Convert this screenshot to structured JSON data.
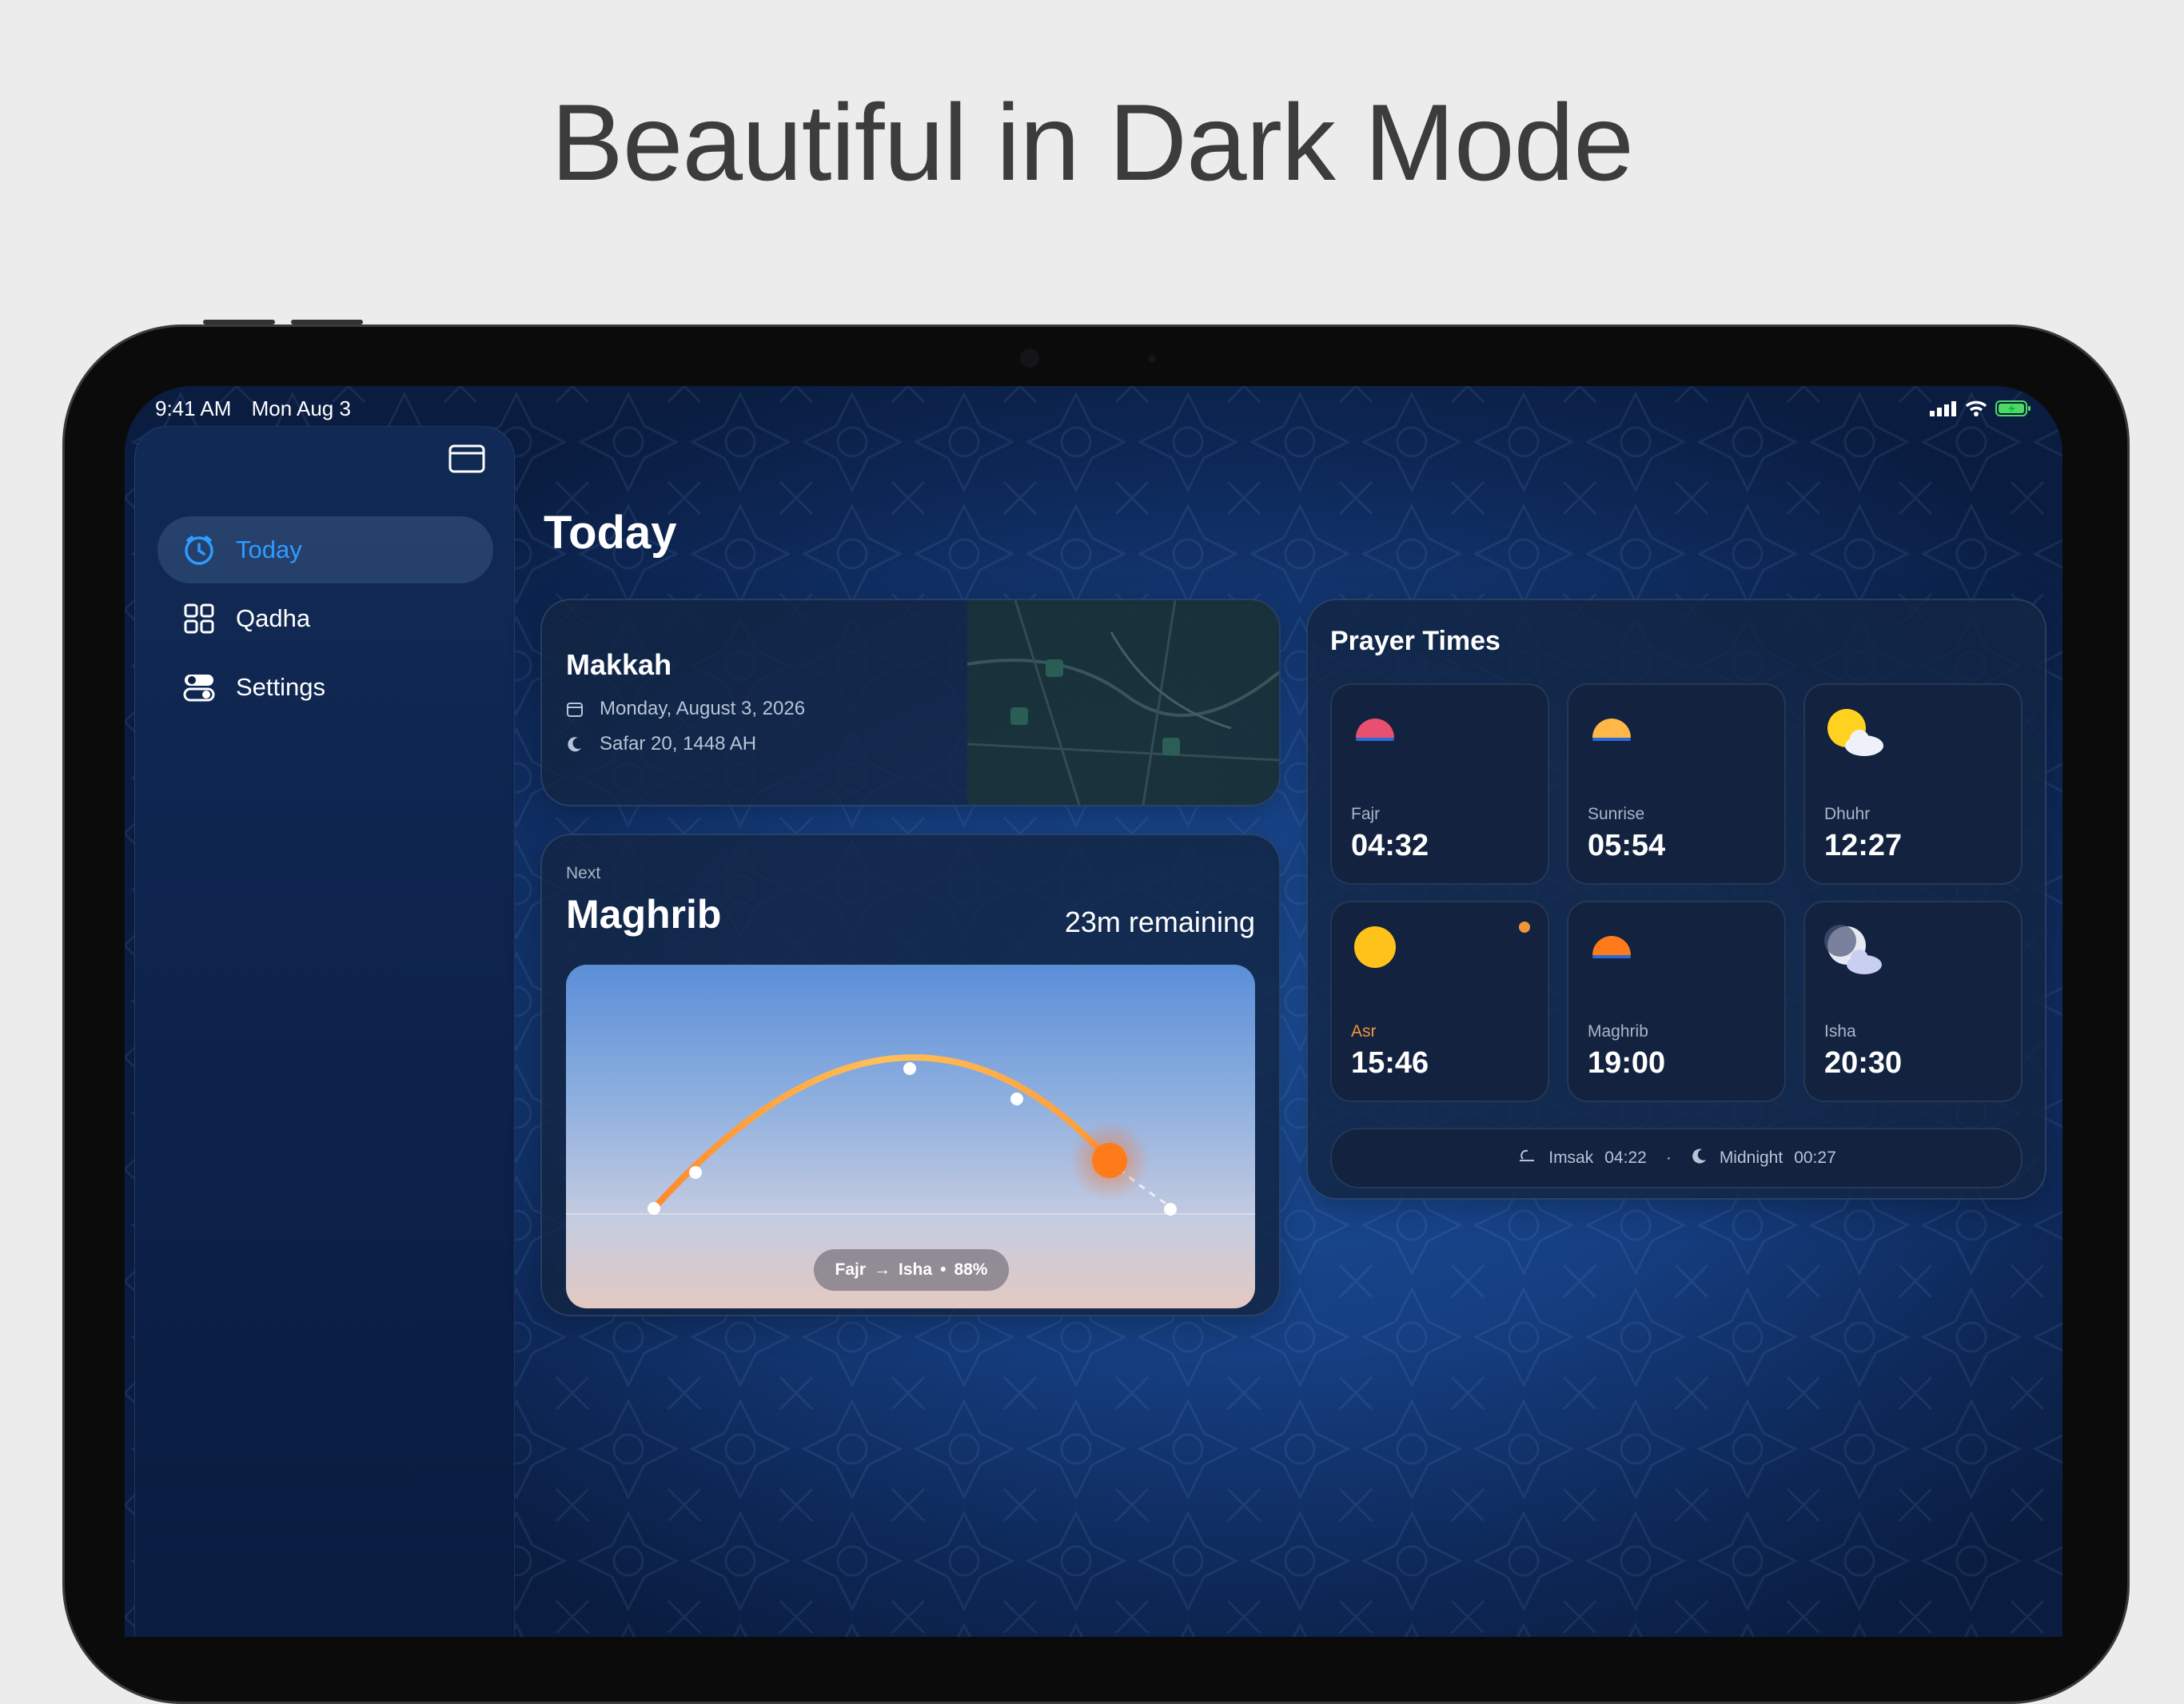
{
  "headline": "Beautiful in Dark Mode",
  "status_bar": {
    "time": "9:41 AM",
    "date": "Mon Aug 3"
  },
  "sidebar": {
    "items": [
      {
        "label": "Today",
        "icon": "clock-icon",
        "active": true
      },
      {
        "label": "Qadha",
        "icon": "grid-icon",
        "active": false
      },
      {
        "label": "Settings",
        "icon": "toggles-icon",
        "active": false
      }
    ]
  },
  "page_title": "Today",
  "location": {
    "city": "Makkah",
    "gregorian_date": "Monday, August 3, 2026",
    "hijri_date": "Safar 20, 1448 AH"
  },
  "next_prayer": {
    "label": "Next",
    "name": "Maghrib",
    "remaining": "23m remaining",
    "progress": {
      "from": "Fajr",
      "to": "Isha",
      "percent": "88%"
    }
  },
  "prayer_times": {
    "title": "Prayer Times",
    "items": [
      {
        "name": "Fajr",
        "time": "04:32",
        "icon": "dawn-sun-icon"
      },
      {
        "name": "Sunrise",
        "time": "05:54",
        "icon": "sunrise-icon"
      },
      {
        "name": "Dhuhr",
        "time": "12:27",
        "icon": "sun-cloud-icon"
      },
      {
        "name": "Asr",
        "time": "15:46",
        "icon": "sun-icon",
        "current": true
      },
      {
        "name": "Maghrib",
        "time": "19:00",
        "icon": "sunset-icon"
      },
      {
        "name": "Isha",
        "time": "20:30",
        "icon": "moon-cloud-icon"
      }
    ],
    "imsak": {
      "label": "Imsak",
      "time": "04:22"
    },
    "midnight": {
      "label": "Midnight",
      "time": "00:27"
    }
  },
  "colors": {
    "accent": "#2f9bff",
    "current": "#f0953a",
    "arc": "#f7a53c"
  }
}
